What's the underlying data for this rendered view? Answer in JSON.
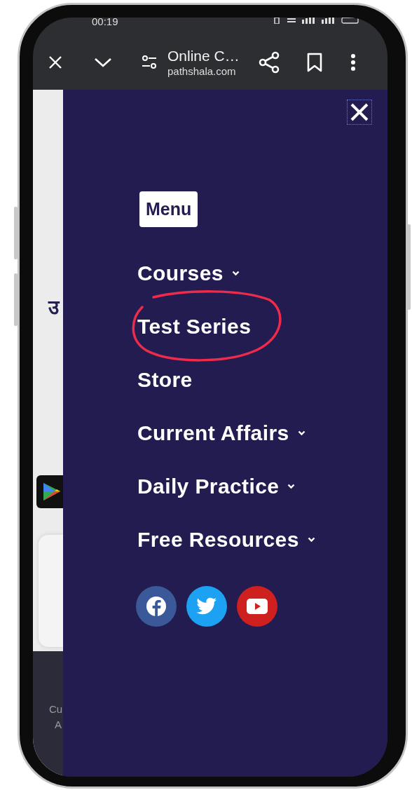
{
  "status_bar": {
    "time": "00:19"
  },
  "browser": {
    "title": "Online C…",
    "url": "pathshala.com"
  },
  "page_behind": {
    "texts": [
      "उ"
    ],
    "footer": [
      "Cu",
      "A"
    ]
  },
  "menu": {
    "heading": "Menu",
    "items": [
      {
        "label": "Courses",
        "has_submenu": true
      },
      {
        "label": "Test Series",
        "has_submenu": false
      },
      {
        "label": "Store",
        "has_submenu": false
      },
      {
        "label": "Current Affairs",
        "has_submenu": true
      },
      {
        "label": "Daily Practice",
        "has_submenu": true
      },
      {
        "label": "Free Resources",
        "has_submenu": true
      }
    ],
    "social": [
      {
        "kind": "facebook",
        "color": "#3b5998"
      },
      {
        "kind": "twitter",
        "color": "#1da1f2"
      },
      {
        "kind": "youtube",
        "color": "#cd201f"
      }
    ]
  },
  "annotation": {
    "kind": "circle",
    "color": "#ee2b4b"
  }
}
